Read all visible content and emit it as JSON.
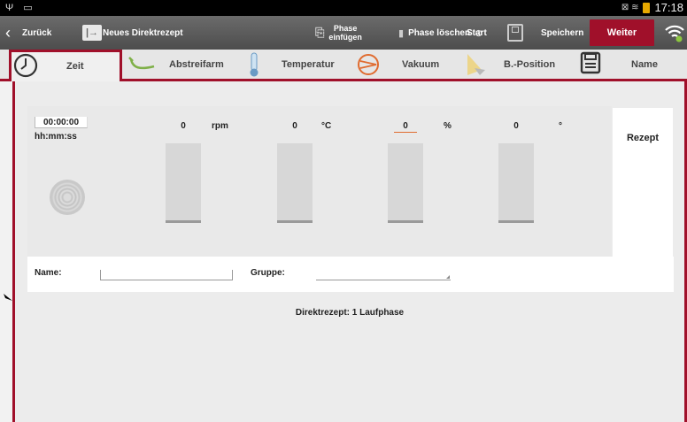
{
  "status_bar": {
    "left_icons": "Ψ ▭",
    "right_icons": "⊠ ≋",
    "time": "17:18"
  },
  "action_bar": {
    "back_label": "Zurück",
    "direkt_label": "Neues Direktrezept",
    "phase_einfuegen_line1": "Phase",
    "phase_einfuegen_line2": "einfügen",
    "phase_loeschen_label": "Phase löschen",
    "start_label": "Start",
    "save_label": "Speichern",
    "weiter_label": "Weiter"
  },
  "tabs": [
    {
      "label": "Zeit",
      "icon": "clock-icon",
      "active": true
    },
    {
      "label": "Abstreifarm",
      "icon": "arm-icon",
      "active": false
    },
    {
      "label": "Temperatur",
      "icon": "thermometer-icon",
      "active": false
    },
    {
      "label": "Vakuum",
      "icon": "vacuum-icon",
      "active": false
    },
    {
      "label": "B.-Position",
      "icon": "position-icon",
      "active": false
    },
    {
      "label": "Name",
      "icon": "save-icon",
      "active": false
    }
  ],
  "params": {
    "time": {
      "value": "00:00:00",
      "unit": "hh:mm:ss"
    },
    "speed": {
      "value": "0",
      "unit": "rpm"
    },
    "temperature": {
      "value": "0",
      "unit": "°C"
    },
    "vacuum": {
      "value": "0",
      "unit": "%"
    },
    "position": {
      "value": "0",
      "unit": "°"
    }
  },
  "rezept_label": "Rezept",
  "fields": {
    "name_label": "Name:",
    "name_value": "",
    "gruppe_label": "Gruppe:",
    "gruppe_value": ""
  },
  "footer_note": "Direktrezept: 1 Laufphase",
  "colors": {
    "accent": "#a0102a",
    "vacuum_underline": "#e06b2f"
  }
}
